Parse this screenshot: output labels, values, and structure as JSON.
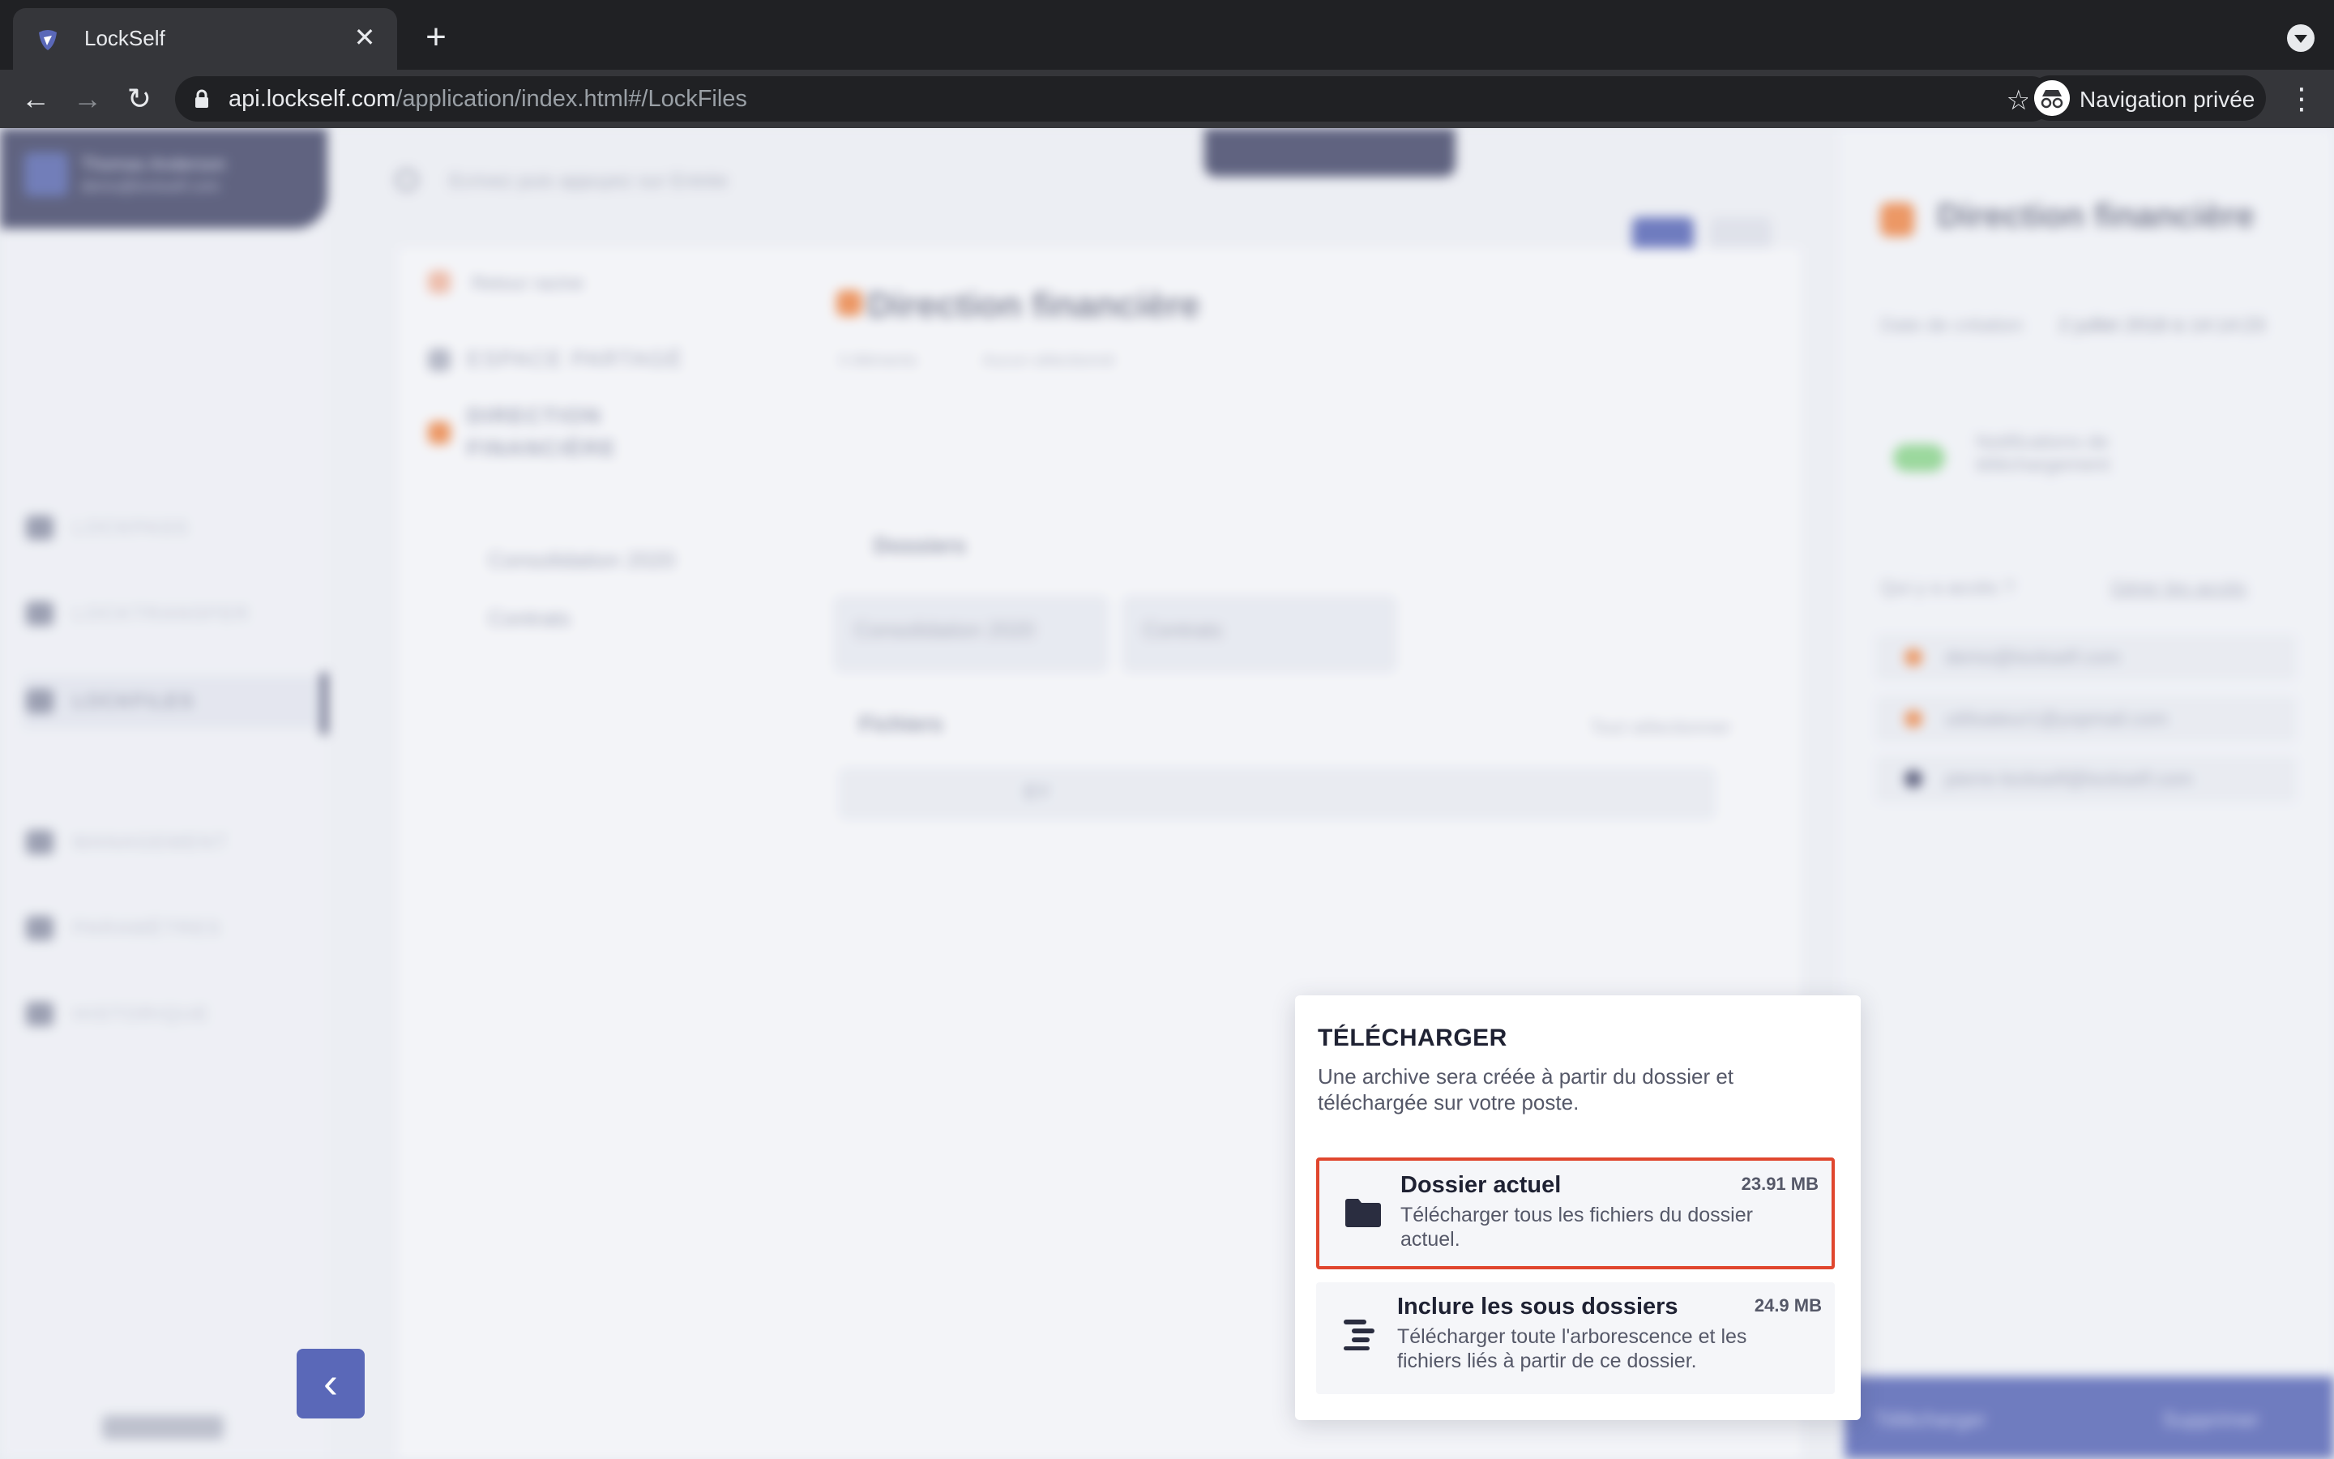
{
  "browser": {
    "tab_title": "LockSelf",
    "url_domain": "api.lockself.com",
    "url_path": "/application/index.html#/LockFiles",
    "private_label": "Navigation privée",
    "new_tab_symbol": "+",
    "close_symbol": "✕"
  },
  "app": {
    "user": {
      "name": "Thomas Anderson",
      "email": "demo@lockself.com",
      "initials": "TA"
    },
    "search_placeholder": "Ecrivez puis appuyez sur Entrée",
    "sidebar": {
      "items": [
        {
          "label": "LOCKPASS",
          "icon": "key-icon"
        },
        {
          "label": "LOCKTRANSFER",
          "icon": "send-icon"
        },
        {
          "label": "LOCKFILES",
          "icon": "files-icon",
          "active": true
        },
        {
          "label": "MANAGEMENT",
          "icon": "user-icon"
        },
        {
          "label": "PARAMÈTRES",
          "icon": "wrench-icon"
        },
        {
          "label": "HISTORIQUE",
          "icon": "history-icon"
        }
      ],
      "collapse_symbol": "‹"
    },
    "tree": {
      "back_root": "Retour racine",
      "shared_space": "ESPACE PARTAGÉ",
      "group_line1": "DIRECTION",
      "group_line2": "FINANCIÈRE",
      "folders": [
        "Consolidation 2020",
        "Contrats"
      ]
    },
    "content": {
      "title": "Direction financière",
      "subtitle": "3 éléments",
      "subtitle_extra": "Aucun sélectionné",
      "folders_header": "Dossiers",
      "folders": [
        "Consolidation 2020",
        "Contrats"
      ],
      "files_header": "Fichiers",
      "select_all": "Tout sélectionner",
      "file_name": "EY"
    },
    "details": {
      "title": "Direction financière",
      "created_label": "Date de création",
      "created_value": "2 juillet 2018 à 14:14:23",
      "notif_label": "Notifications de téléchargement",
      "access_label": "Qui y a accès ?",
      "manage_access": "Gérer les accès",
      "access_list": [
        "demo@lockself.com",
        "utilisateur1@yopmail.com",
        "pierre-lockself@lockself.com"
      ],
      "download_btn": "Télécharger",
      "delete_btn": "Supprimer"
    }
  },
  "popover": {
    "title": "TÉLÉCHARGER",
    "description": "Une archive sera créée à partir du dossier et téléchargée sur votre poste.",
    "options": [
      {
        "title": "Dossier actuel",
        "size": "23.91 MB",
        "description": "Télécharger tous les fichiers du dossier actuel.",
        "icon": "folder-icon",
        "selected": true
      },
      {
        "title": "Inclure les sous dossiers",
        "size": "24.9 MB",
        "description": "Télécharger toute l'arborescence et les fichiers liés à partir de ce dossier.",
        "icon": "tree-icon",
        "selected": false
      }
    ]
  },
  "colors": {
    "accent": "#5a68b8",
    "dark": "#474a6b",
    "orange": "#f28a4a",
    "highlight": "#e0462e"
  }
}
